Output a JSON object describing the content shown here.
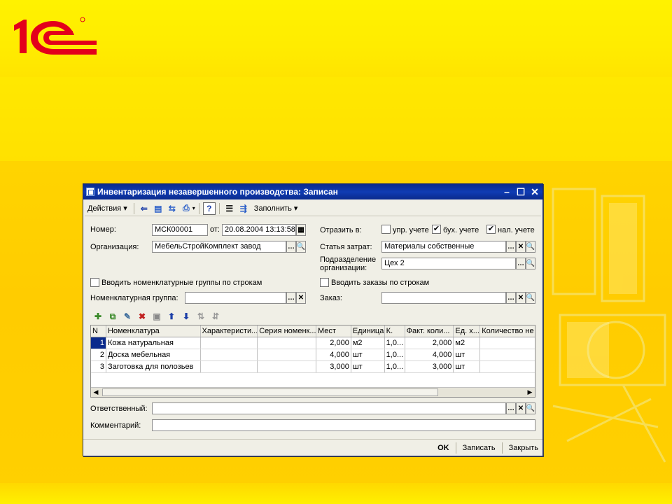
{
  "window": {
    "title": "Инвентаризация незавершенного производства: Записан"
  },
  "toolbar": {
    "actions_label": "Действия",
    "fill_label": "Заполнить",
    "help_label": "?"
  },
  "form": {
    "number_label": "Номер:",
    "number_value": "МСК00001",
    "date_label": "от:",
    "date_value": "20.08.2004 13:13:58",
    "org_label": "Организация:",
    "org_value": "МебельСтройКомплект завод",
    "reflect_label": "Отразить в:",
    "reflect_mgmt_label": "упр. учете",
    "reflect_mgmt_checked": false,
    "reflect_acc_label": "бух. учете",
    "reflect_acc_checked": true,
    "reflect_tax_label": "нал. учете",
    "reflect_tax_checked": true,
    "cost_item_label": "Статья затрат:",
    "cost_item_value": "Материалы собственные",
    "division_label_1": "Подразделение",
    "division_label_2": "организации:",
    "division_value": "Цех 2",
    "enter_groups_label": "Вводить номенклатурные группы по строкам",
    "enter_orders_label": "Вводить заказы по строкам",
    "nom_group_label": "Номенклатурная группа:",
    "nom_group_value": "",
    "order_label": "Заказ:",
    "order_value": "",
    "responsible_label": "Ответственный:",
    "responsible_value": "",
    "comment_label": "Комментарий:",
    "comment_value": ""
  },
  "table": {
    "columns": [
      "N",
      "Номенклатура",
      "Характеристи...",
      "Серия номенк...",
      "Мест",
      "Единица",
      "К.",
      "Факт. коли...",
      "Ед. х...",
      "Количество не"
    ],
    "rows": [
      [
        "1",
        "Кожа натуральная",
        "",
        "",
        "2,000",
        "м2",
        "1,0...",
        "2,000",
        "м2",
        ""
      ],
      [
        "2",
        "Доска мебельная",
        "",
        "",
        "4,000",
        "шт",
        "1,0...",
        "4,000",
        "шт",
        ""
      ],
      [
        "3",
        "Заготовка для полозьев",
        "",
        "",
        "3,000",
        "шт",
        "1,0...",
        "3,000",
        "шт",
        ""
      ]
    ]
  },
  "buttons": {
    "ok": "OK",
    "save": "Записать",
    "close": "Закрыть"
  },
  "colors": {
    "titlebar": "#0f3cb4",
    "background": "#ffd400",
    "logo": "#e3001b"
  }
}
